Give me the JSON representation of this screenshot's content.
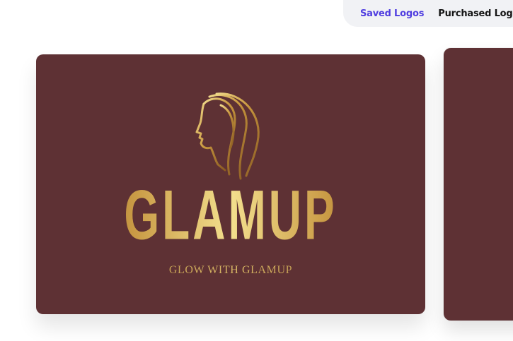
{
  "tabs": {
    "saved_label": "Saved Logos",
    "purchased_label": "Purchased Logos"
  },
  "logo_card": {
    "brand_name": "GLAMUP",
    "tagline": "GLOW WITH GLAMUP",
    "icon": "woman-face-hair-icon"
  },
  "colors": {
    "card_background": "#5e3134",
    "gold_dark": "#8a5a22",
    "gold_light": "#f3e08e",
    "accent": "#4f3de0"
  }
}
